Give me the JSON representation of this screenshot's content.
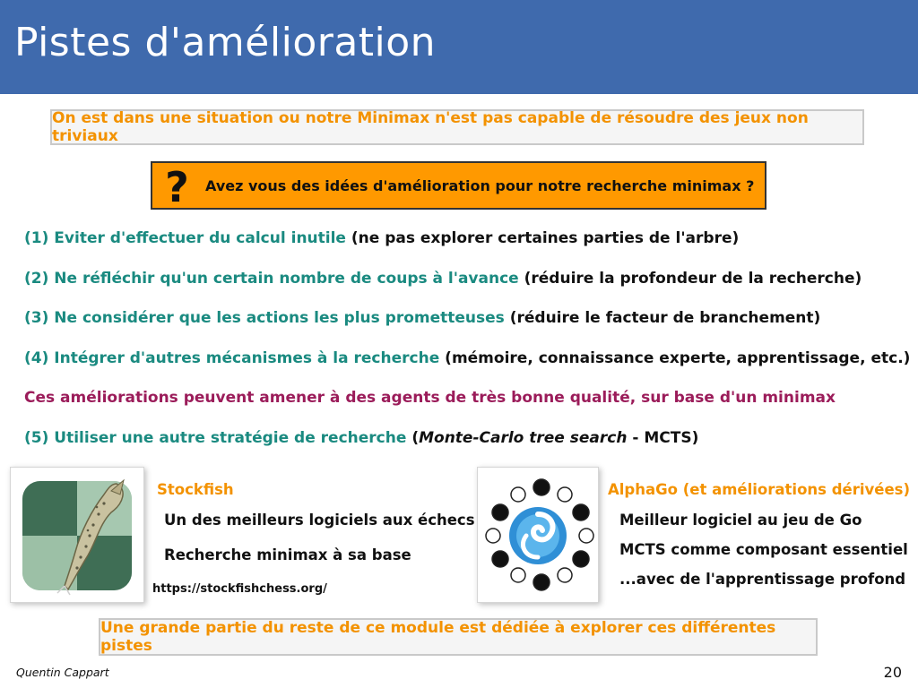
{
  "header": {
    "title": "Pistes d'amélioration"
  },
  "callout_top": "On est dans une situation ou notre Minimax n'est pas capable de résoudre des jeux non triviaux",
  "question": {
    "mark": "?",
    "text": "Avez vous des idées d'amélioration pour notre recherche minimax ?"
  },
  "points": [
    {
      "num": "(1)",
      "teal": "Eviter d'effectuer du calcul inutile",
      "dark": "(ne pas explorer certaines parties de l'arbre)"
    },
    {
      "num": "(2)",
      "teal": "Ne réfléchir qu'un certain nombre de coups à l'avance",
      "dark": "(réduire la profondeur de la recherche)"
    },
    {
      "num": "(3)",
      "teal": "Ne considérer que les actions les plus prometteuses",
      "dark": "(réduire le facteur de branchement)"
    },
    {
      "num": "(4)",
      "teal": "Intégrer d'autres mécanismes à la recherche",
      "dark": "(mémoire, connaissance experte, apprentissage, etc.)"
    }
  ],
  "note": "Ces améliorations peuvent amener à des agents de très bonne qualité, sur base d'un minimax",
  "point5": {
    "num": "(5)",
    "teal": "Utiliser une autre stratégie de recherche",
    "open": "(",
    "italic": "Monte-Carlo tree search",
    "rest": " - MCTS)"
  },
  "stockfish": {
    "heading": "Stockfish",
    "lines": [
      "Un des meilleurs logiciels aux échecs",
      "Recherche minimax à sa base"
    ],
    "link": "https://stockfishchess.org/"
  },
  "alphago": {
    "heading": "AlphaGo (et améliorations dérivées)",
    "lines": [
      "Meilleur logiciel au jeu de Go",
      "MCTS comme composant essentiel",
      "...avec de l'apprentissage profond"
    ]
  },
  "callout_bottom": "Une grande partie du reste de ce module est dédiée à explorer ces différentes pistes",
  "footer": {
    "author": "Quentin Cappart",
    "page": "20"
  },
  "colors": {
    "header": "#3f6aad",
    "orange": "#f39200",
    "teal": "#1a8a80",
    "purple": "#9b1c5a",
    "question_bg": "#ff9900"
  },
  "icons": {
    "stockfish_logo": "stockfish-fish-logo",
    "alphago_logo": "alphago-logo"
  }
}
